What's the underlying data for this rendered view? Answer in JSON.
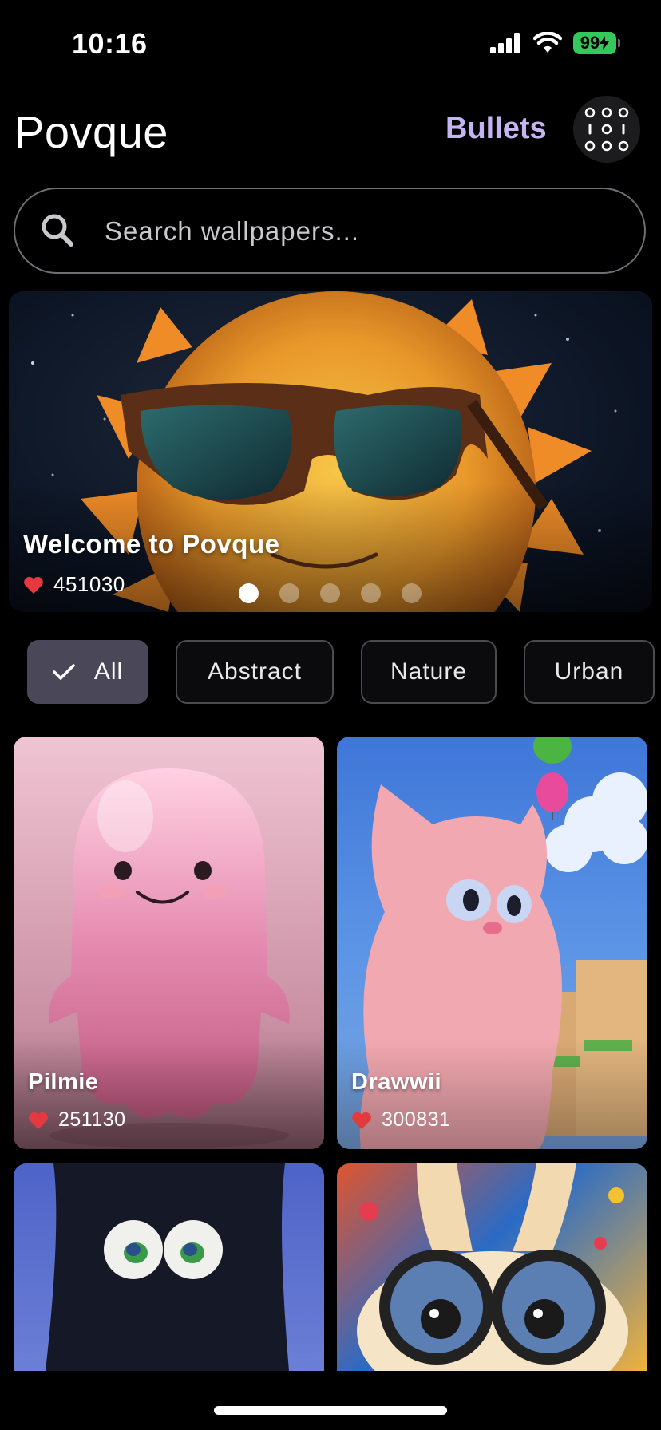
{
  "status_bar": {
    "time": "10:16",
    "battery": "99"
  },
  "header": {
    "title": "Povque",
    "bullets_label": "Bullets"
  },
  "search": {
    "placeholder": "Search wallpapers..."
  },
  "hero": {
    "title": "Welcome to Povque",
    "likes": "451030",
    "slide_count": 5,
    "active_slide": 0
  },
  "categories": [
    {
      "label": "All",
      "selected": true
    },
    {
      "label": "Abstract",
      "selected": false
    },
    {
      "label": "Nature",
      "selected": false
    },
    {
      "label": "Urban",
      "selected": false
    }
  ],
  "wallpapers": [
    {
      "title": "Pilmie",
      "likes": "251130"
    },
    {
      "title": "Drawwii",
      "likes": "300831"
    },
    {
      "title": "",
      "likes": ""
    },
    {
      "title": "",
      "likes": ""
    }
  ],
  "colors": {
    "accent": "#c5b4f2",
    "like_heart": "#e5393f",
    "battery": "#34c759",
    "chip_selected": "#4a4858"
  }
}
